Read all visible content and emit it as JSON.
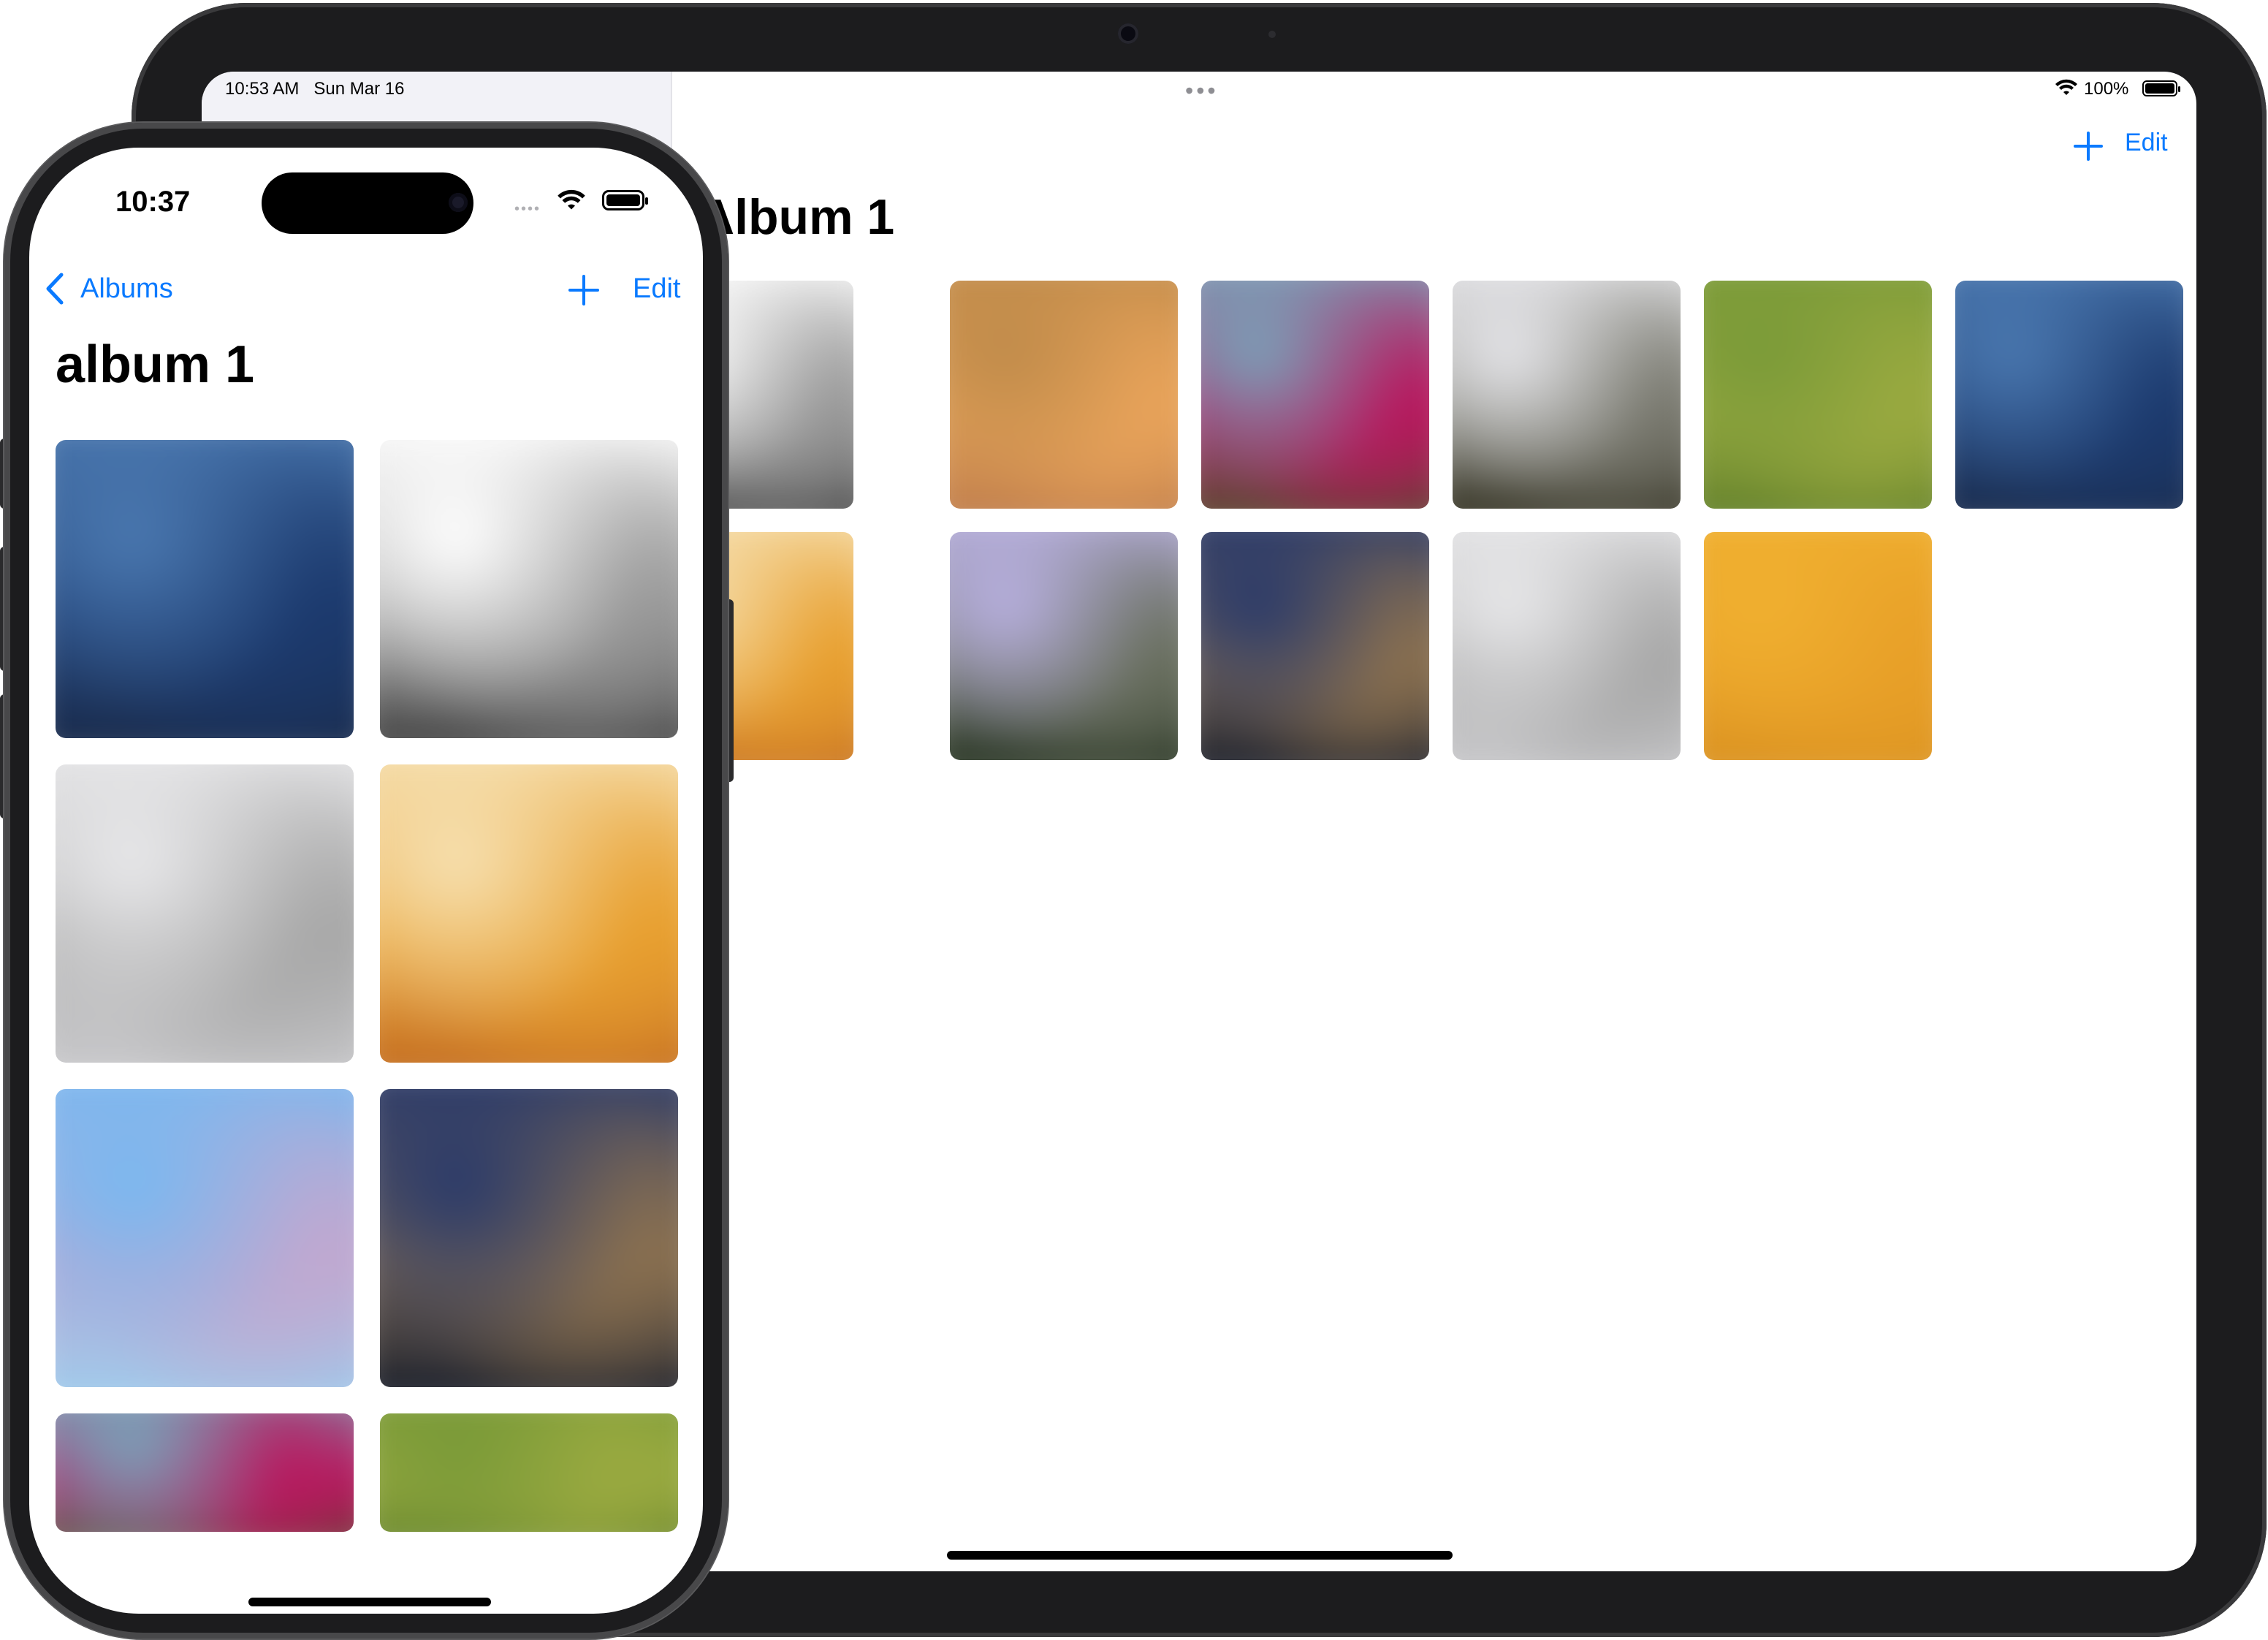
{
  "ipad": {
    "status_bar": {
      "time": "10:53 AM",
      "date": "Sun Mar 16",
      "battery": "100%"
    },
    "nav": {
      "add_icon": "plus-icon",
      "edit_label": "Edit"
    },
    "title": "Album 1",
    "photos": [
      {
        "name": "photo-grayscale",
        "colors": [
          "#ffffff",
          "#9a9a9a",
          "#3a3a3a"
        ]
      },
      {
        "name": "photo-orange",
        "colors": [
          "#c08b4a",
          "#e8a35a",
          "#b8774a"
        ]
      },
      {
        "name": "photo-magenta-flowers",
        "colors": [
          "#7aa0b8",
          "#b8185e",
          "#4a5028"
        ]
      },
      {
        "name": "photo-gray-dark",
        "colors": [
          "#e6e6ea",
          "#7a7a70",
          "#2a2818"
        ]
      },
      {
        "name": "photo-green",
        "colors": [
          "#7a9a38",
          "#9aaa40",
          "#5a7a28"
        ]
      },
      {
        "name": "photo-blue-ocean",
        "colors": [
          "#4a78b0",
          "#1c3a6e",
          "#1a2a48"
        ]
      },
      {
        "name": "photo-yellow-flower",
        "colors": [
          "#f6e0b0",
          "#e8a030",
          "#c06820"
        ]
      },
      {
        "name": "photo-lavender",
        "colors": [
          "#b8b0e0",
          "#6a7060",
          "#1c2a18"
        ]
      },
      {
        "name": "photo-dusk",
        "colors": [
          "#2a3a6a",
          "#8a7050",
          "#0a1428"
        ]
      },
      {
        "name": "photo-light-gray",
        "colors": [
          "#e8e8ea",
          "#a8a8a8",
          "#cfcfd2"
        ]
      },
      {
        "name": "photo-yellow-orange",
        "colors": [
          "#f0b030",
          "#e8a028",
          "#d89020"
        ]
      }
    ]
  },
  "iphone": {
    "status_bar": {
      "time": "10:37"
    },
    "nav": {
      "back_label": "Albums",
      "add_icon": "plus-icon",
      "edit_label": "Edit"
    },
    "title": "album 1",
    "photos": [
      {
        "name": "photo-blue-ocean",
        "colors": [
          "#4a78b0",
          "#1c3a6e",
          "#1a2a48"
        ]
      },
      {
        "name": "photo-grayscale",
        "colors": [
          "#ffffff",
          "#9a9a9a",
          "#3a3a3a"
        ]
      },
      {
        "name": "photo-light-gray",
        "colors": [
          "#e8e8ea",
          "#a8a8a8",
          "#cfcfd2"
        ]
      },
      {
        "name": "photo-yellow-flower",
        "colors": [
          "#f6e0b0",
          "#e8a030",
          "#c06820"
        ]
      },
      {
        "name": "photo-light-blue",
        "colors": [
          "#7ab8f0",
          "#c0a8d0",
          "#9ad0f0"
        ]
      },
      {
        "name": "photo-dusk",
        "colors": [
          "#2a3a6a",
          "#8a7050",
          "#0a1428"
        ]
      },
      {
        "name": "photo-magenta-flowers",
        "colors": [
          "#7aa0b8",
          "#b8185e",
          "#4a5028"
        ]
      },
      {
        "name": "photo-green",
        "colors": [
          "#7a9a38",
          "#9aaa40",
          "#5a7a28"
        ]
      }
    ]
  },
  "accent_color": "#0a7aff"
}
